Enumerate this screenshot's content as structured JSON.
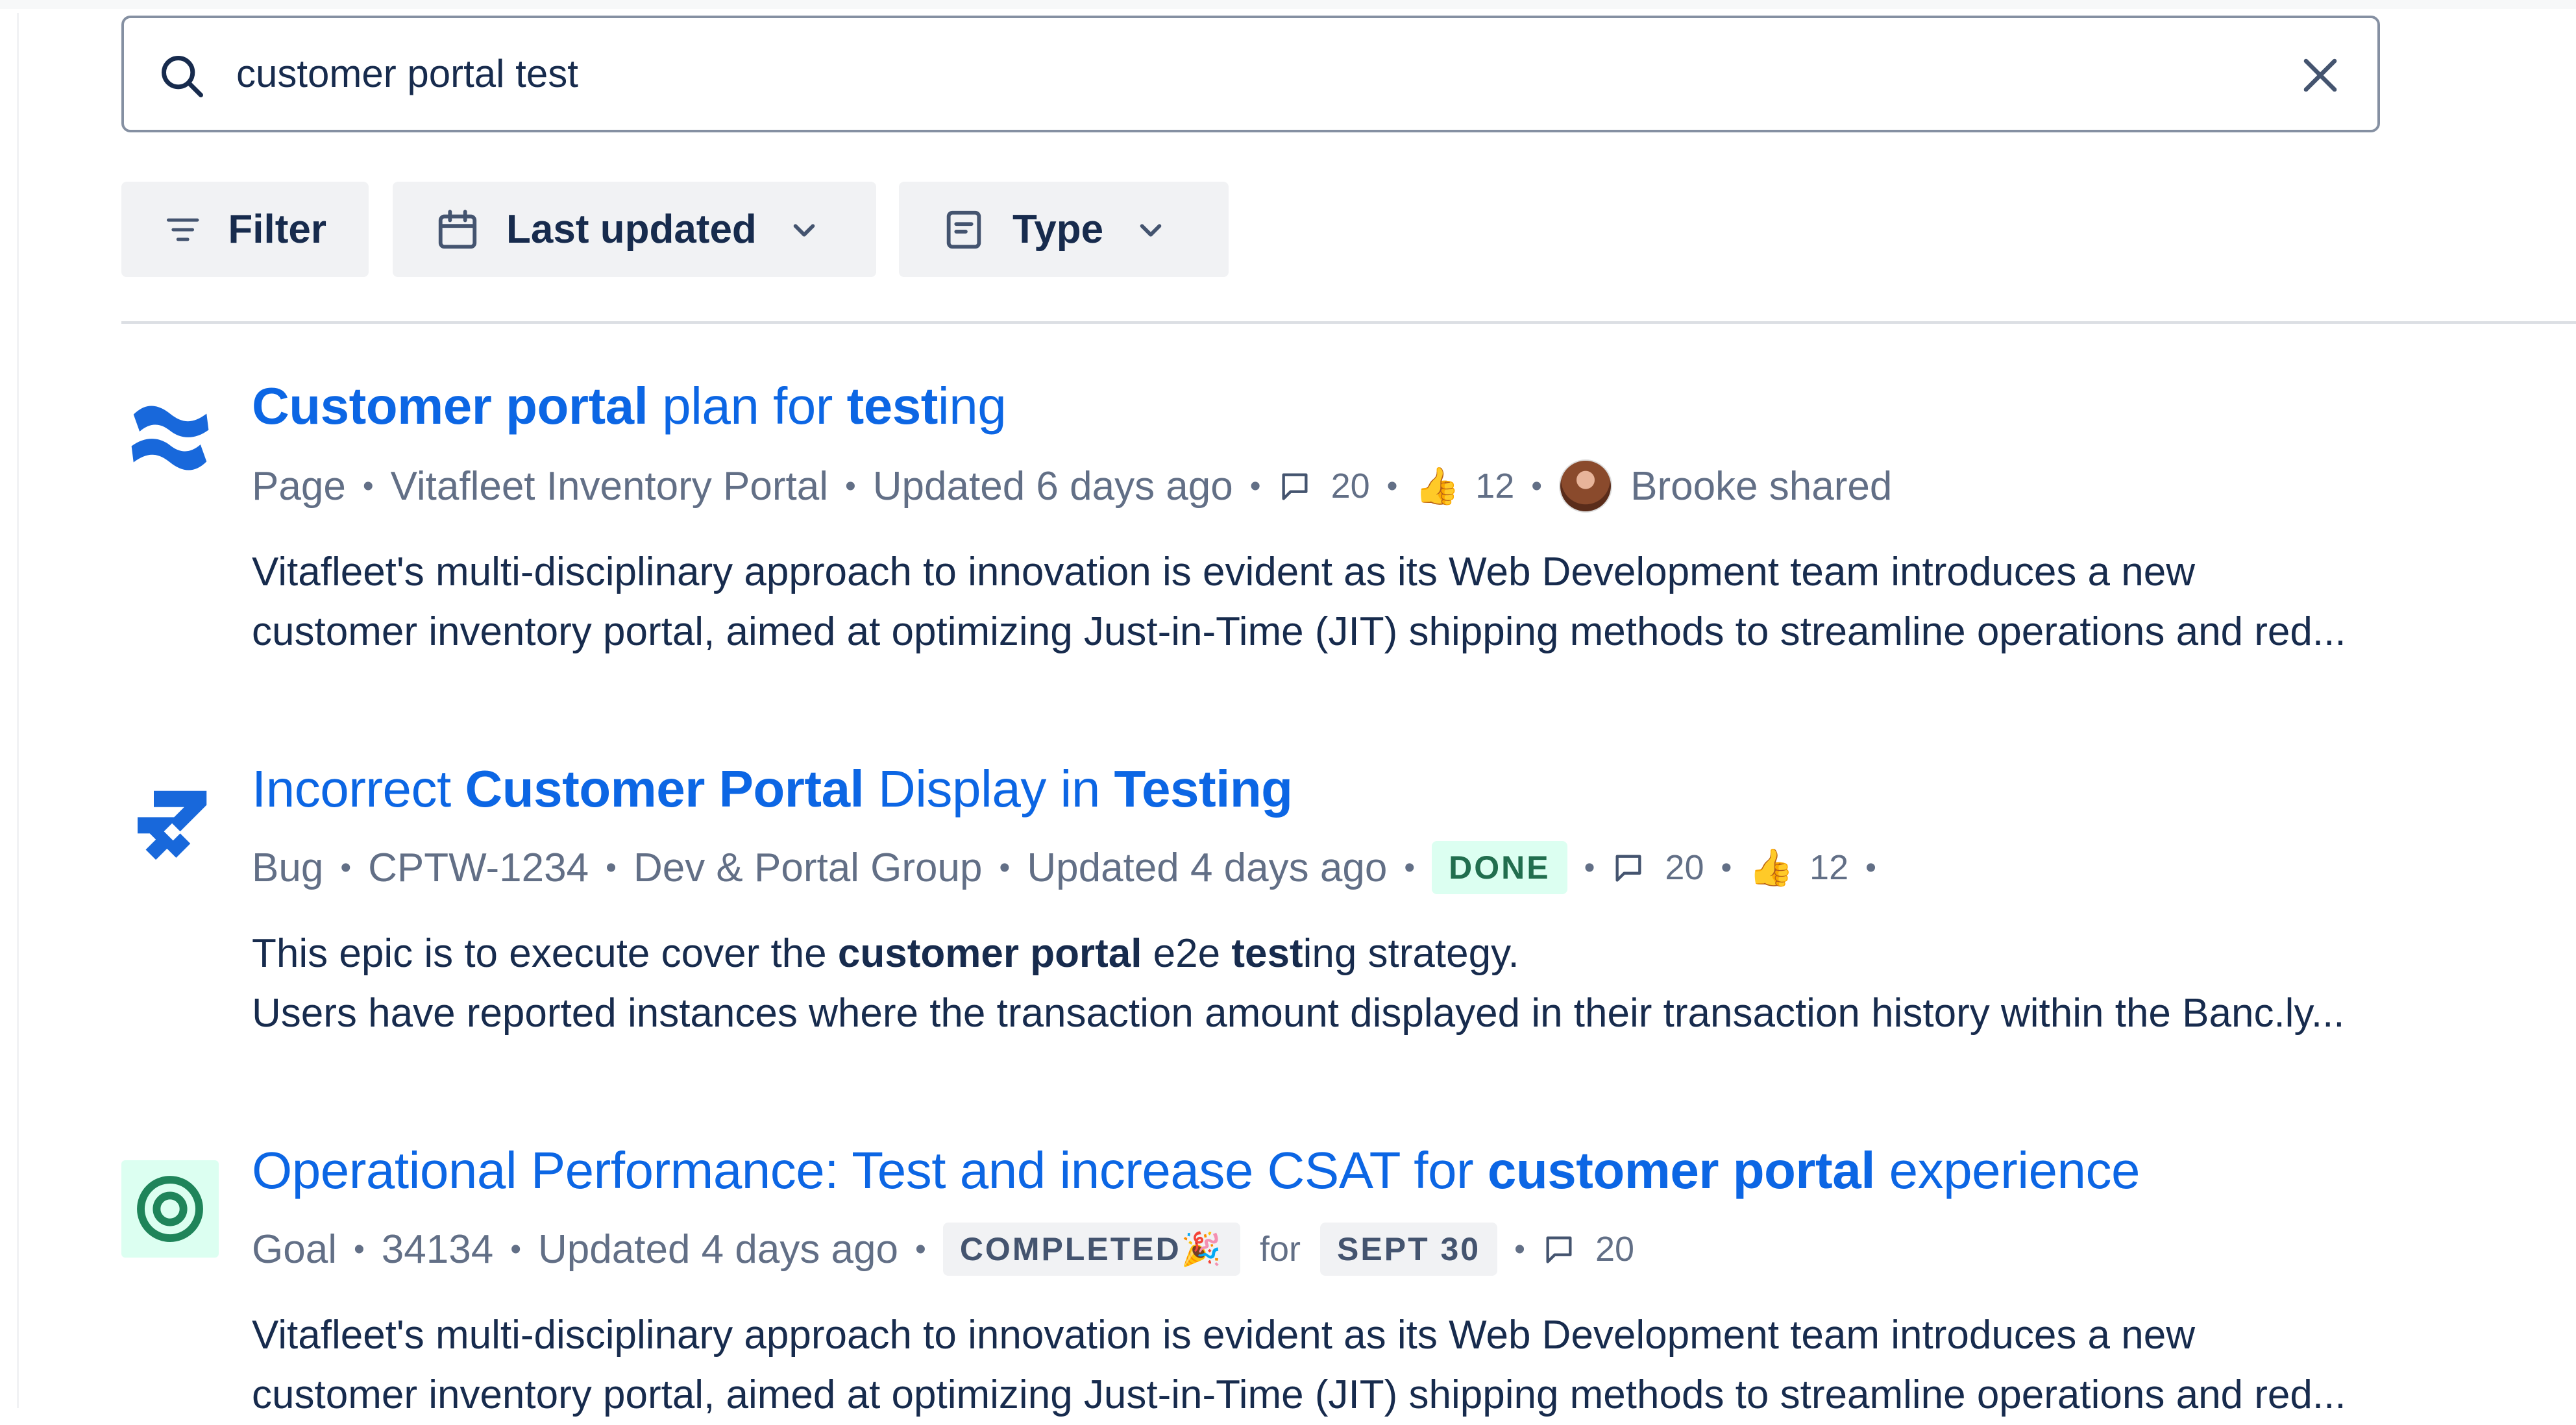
{
  "search": {
    "query": "customer portal test",
    "clear_label": "Clear"
  },
  "filters": {
    "filter_label": "Filter",
    "last_updated_label": "Last updated",
    "type_label": "Type"
  },
  "results": [
    {
      "icon": "confluence-icon",
      "title_parts": [
        {
          "text": "Customer portal",
          "bold": true
        },
        {
          "text": " plan for ",
          "bold": false
        },
        {
          "text": "test",
          "bold": true
        },
        {
          "text": "ing",
          "bold": false
        }
      ],
      "meta": {
        "type": "Page",
        "space": "Vitafleet Inventory Portal",
        "updated": "Updated 6 days ago",
        "comments": "20",
        "likes": "12",
        "shared_by": "Brooke shared"
      },
      "desc_line1": "Vitafleet's multi-disciplinary approach to innovation is evident as its Web Development team introduces a new",
      "desc_line2": "customer inventory portal, aimed at optimizing Just-in-Time (JIT) shipping methods to streamline operations and red..."
    },
    {
      "icon": "jira-icon",
      "title_parts": [
        {
          "text": "Incorrect ",
          "bold": false
        },
        {
          "text": "Customer Portal",
          "bold": true
        },
        {
          "text": " Display in ",
          "bold": false
        },
        {
          "text": "Testing",
          "bold": true
        }
      ],
      "meta": {
        "type": "Bug",
        "key": "CPTW-1234",
        "project": "Dev & Portal Group",
        "updated": "Updated 4 days ago",
        "status": "DONE",
        "comments": "20",
        "likes": "12"
      },
      "desc_line1_parts": [
        {
          "text": "This epic is to execute cover the ",
          "bold": false
        },
        {
          "text": "customer portal",
          "bold": true
        },
        {
          "text": " e2e ",
          "bold": false
        },
        {
          "text": "test",
          "bold": true
        },
        {
          "text": "ing strategy.",
          "bold": false
        }
      ],
      "desc_line2": "Users have reported instances where the transaction amount displayed in their transaction history within the Banc.ly..."
    },
    {
      "icon": "goal-icon",
      "title_parts": [
        {
          "text": "Operational Performance: Test and increase CSAT for ",
          "bold": false
        },
        {
          "text": "customer portal",
          "bold": true
        },
        {
          "text": " experience",
          "bold": false
        }
      ],
      "meta": {
        "type": "Goal",
        "key": "34134",
        "updated": "Updated 4 days ago",
        "status": "COMPLETED",
        "status_emoji": "🎉",
        "for_word": "for",
        "target_date": "SEPT 30",
        "comments": "20"
      },
      "desc_line1": "Vitafleet's multi-disciplinary approach to innovation is evident as its Web Development team introduces a new",
      "desc_line2": "customer inventory portal, aimed at optimizing Just-in-Time (JIT) shipping methods to streamline operations and red..."
    }
  ],
  "colors": {
    "link": "#0c66e4",
    "text": "#172b4d",
    "subtle": "#626f86",
    "done_bg": "#dcfff1",
    "done_text": "#216e4e",
    "goal_bg": "#dcfff1",
    "goal_icon": "#1f845a"
  }
}
